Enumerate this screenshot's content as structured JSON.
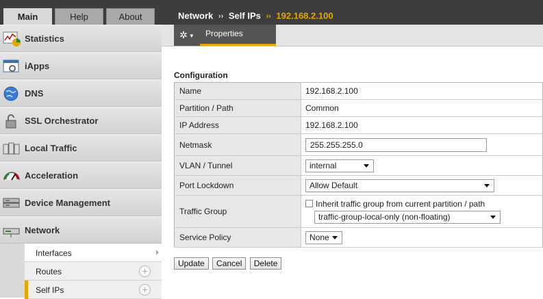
{
  "tabs": {
    "main": "Main",
    "help": "Help",
    "about": "About"
  },
  "nav": {
    "statistics": {
      "label": "Statistics",
      "icon": "statistics-chart-icon"
    },
    "iapps": {
      "label": "iApps",
      "icon": "iapps-icon"
    },
    "dns": {
      "label": "DNS",
      "icon": "globe-icon"
    },
    "ssl": {
      "label": "SSL Orchestrator",
      "icon": "padlock-icon"
    },
    "local_traffic": {
      "label": "Local Traffic",
      "icon": "servers-icon"
    },
    "acceleration": {
      "label": "Acceleration",
      "icon": "speedometer-icon"
    },
    "device_management": {
      "label": "Device Management",
      "icon": "device-icon"
    },
    "network": {
      "label": "Network",
      "icon": "network-switch-icon"
    }
  },
  "network_sub": {
    "interfaces": "Interfaces",
    "routes": "Routes",
    "self_ips": "Self IPs",
    "plus_symbol": "+"
  },
  "breadcrumb": {
    "section": "Network",
    "page": "Self IPs",
    "current": "192.168.2.100",
    "separator": "››"
  },
  "toolbar": {
    "properties_tab": "Properties",
    "gear_symbol": "✲"
  },
  "config": {
    "title": "Configuration",
    "rows": {
      "name": {
        "label": "Name",
        "value": "192.168.2.100"
      },
      "partition": {
        "label": "Partition / Path",
        "value": "Common"
      },
      "ip": {
        "label": "IP Address",
        "value": "192.168.2.100"
      },
      "netmask": {
        "label": "Netmask",
        "value": "255.255.255.0"
      },
      "vlan": {
        "label": "VLAN / Tunnel",
        "value": "internal"
      },
      "port_lockdown": {
        "label": "Port Lockdown",
        "value": "Allow Default"
      },
      "traffic_group": {
        "label": "Traffic Group",
        "inherit_label": "Inherit traffic group from current partition / path",
        "inherit_checked": false,
        "value": "traffic-group-local-only (non-floating)"
      },
      "service_policy": {
        "label": "Service Policy",
        "value": "None"
      }
    }
  },
  "actions": {
    "update": "Update",
    "cancel": "Cancel",
    "delete": "Delete"
  },
  "colors": {
    "accent": "#e5a800",
    "header": "#3d3d3d"
  }
}
